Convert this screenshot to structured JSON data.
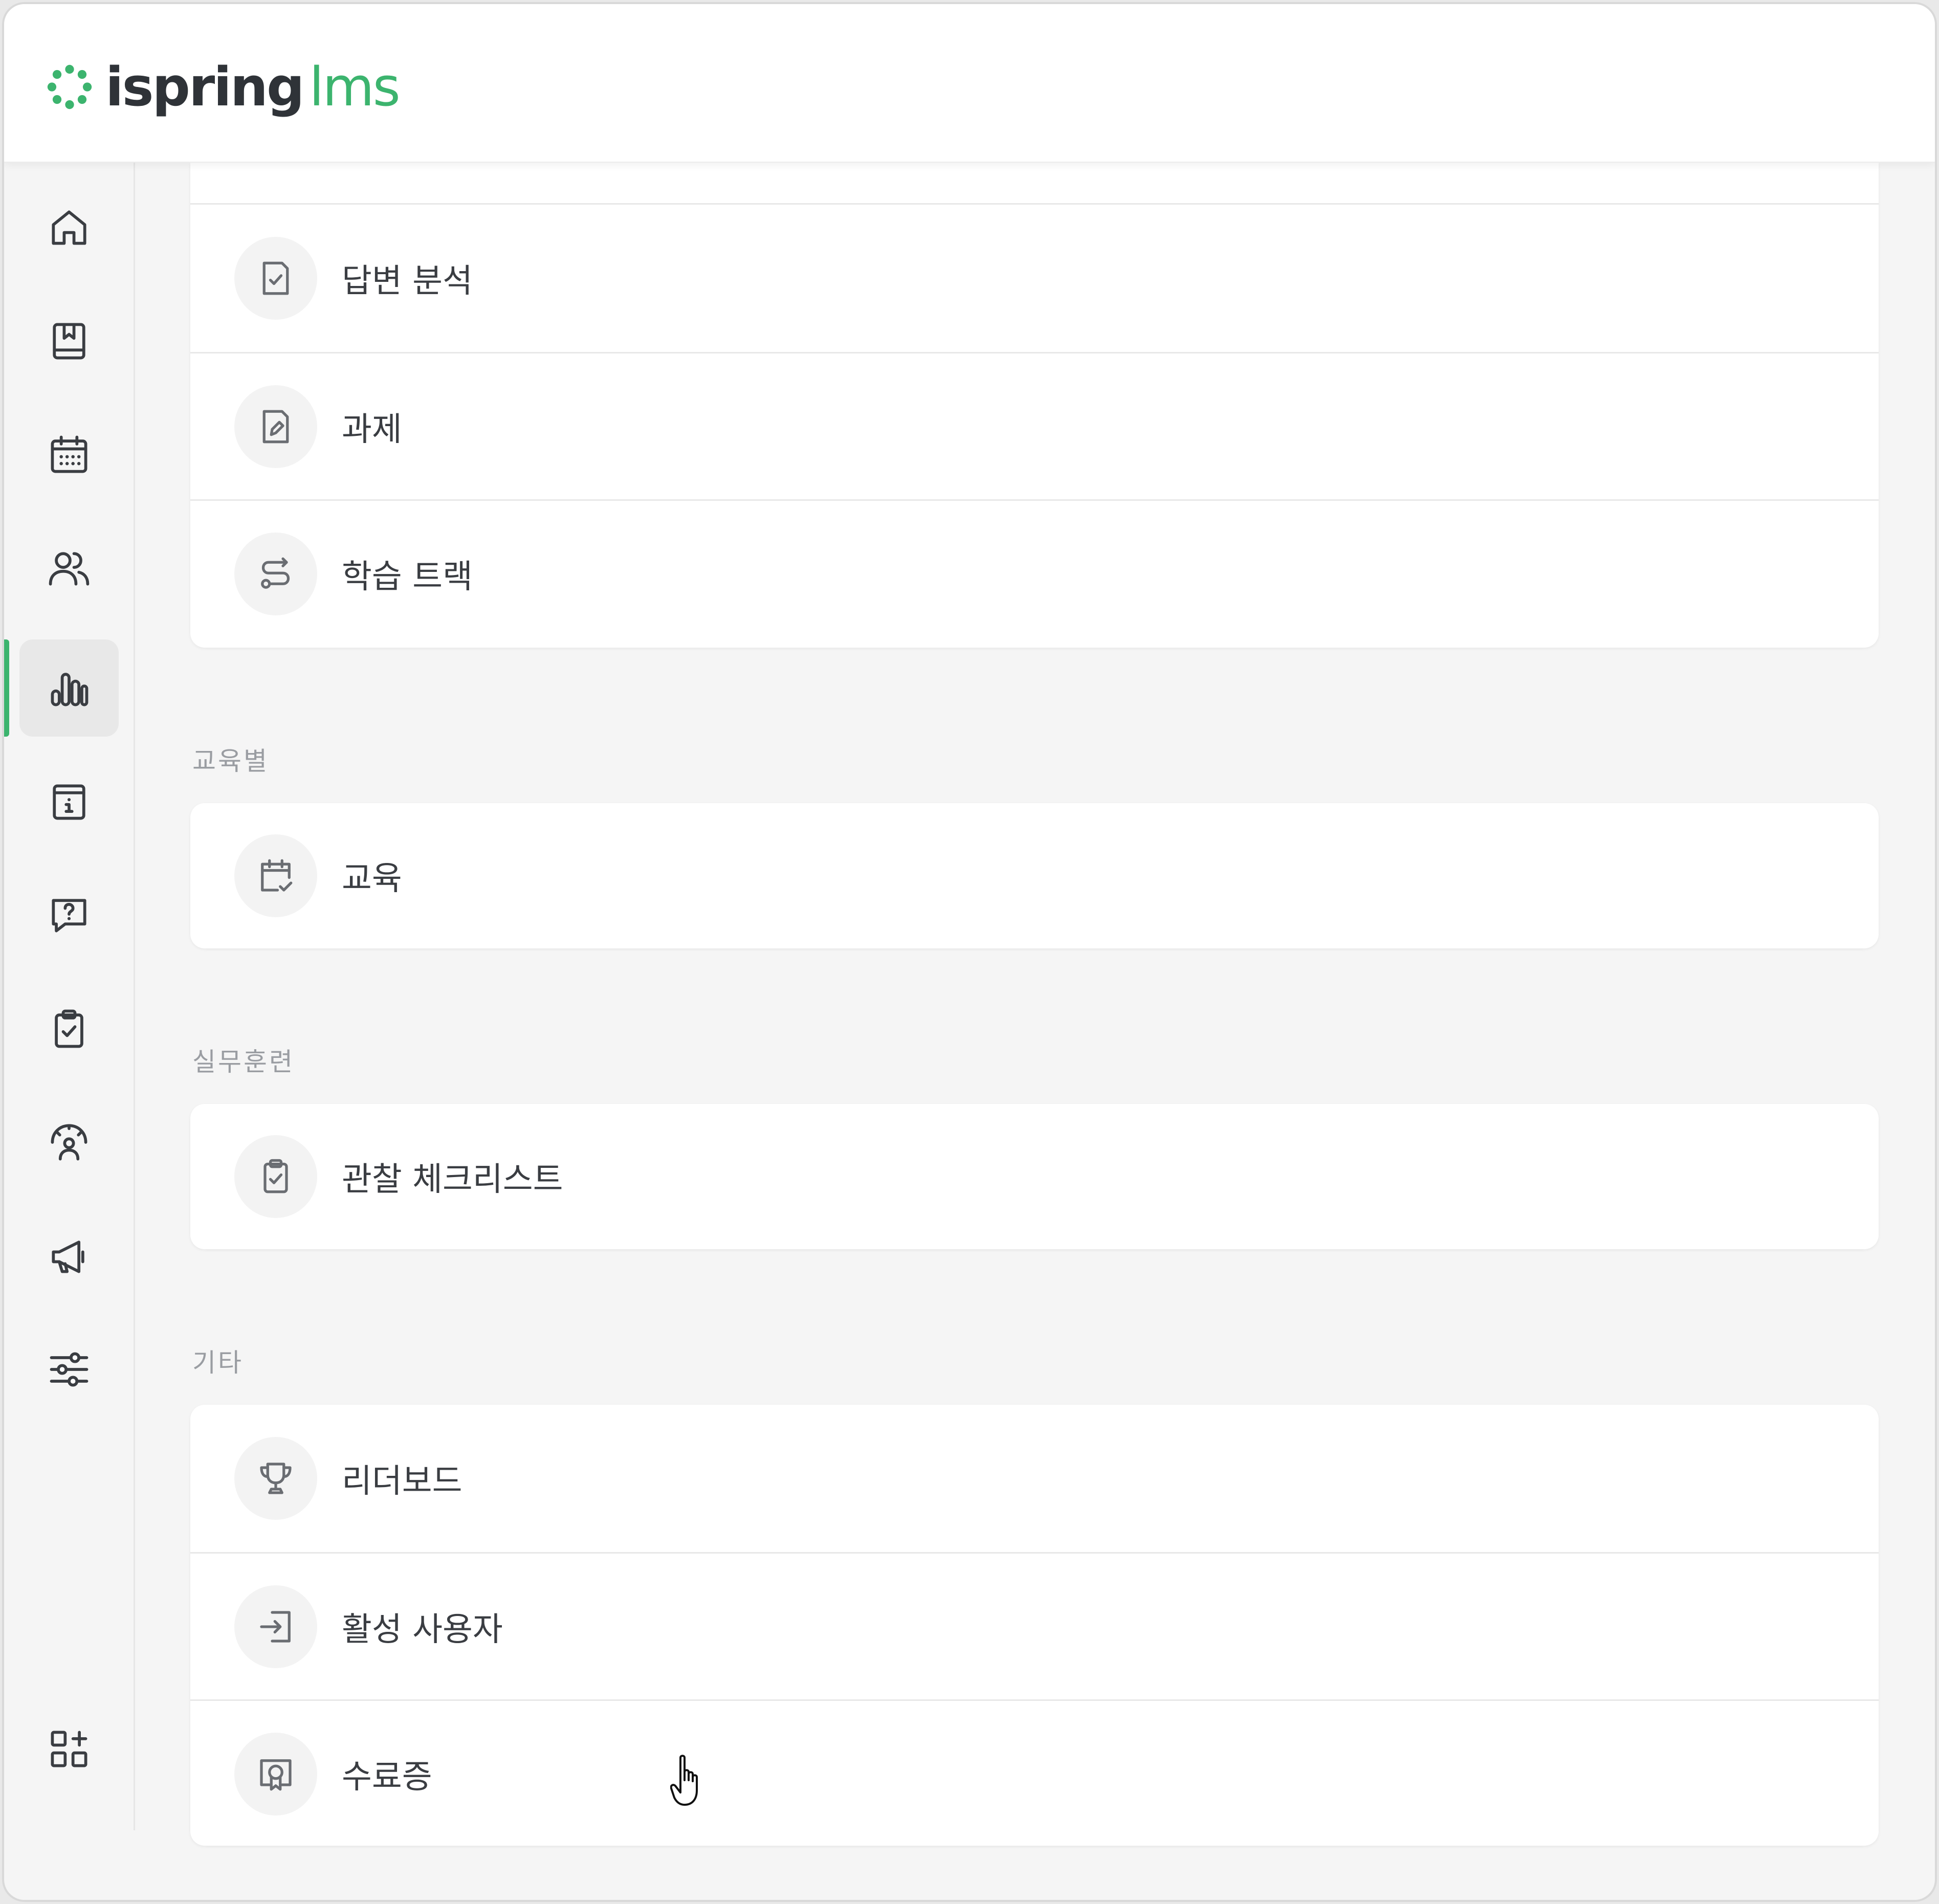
{
  "brand": {
    "name_primary": "ispring",
    "name_secondary": "lms",
    "accent_color": "#3cb46e"
  },
  "sidebar": {
    "active_index": 4,
    "items": [
      {
        "icon": "home-icon"
      },
      {
        "icon": "book-icon"
      },
      {
        "icon": "calendar-icon"
      },
      {
        "icon": "users-icon"
      },
      {
        "icon": "bar-chart-icon"
      },
      {
        "icon": "info-page-icon"
      },
      {
        "icon": "question-chat-icon"
      },
      {
        "icon": "clipboard-check-icon"
      },
      {
        "icon": "gauge-user-icon"
      },
      {
        "icon": "megaphone-icon"
      },
      {
        "icon": "sliders-icon"
      },
      {
        "icon": "apps-add-icon"
      }
    ]
  },
  "sections": {
    "top_group": {
      "items": [
        {
          "label": "답변 분석",
          "icon": "document-check-icon"
        },
        {
          "label": "과제",
          "icon": "document-edit-icon"
        },
        {
          "label": "학습 트랙",
          "icon": "route-icon"
        }
      ]
    },
    "by_training": {
      "title": "교육별",
      "items": [
        {
          "label": "교육",
          "icon": "calendar-check-icon"
        }
      ]
    },
    "practical": {
      "title": "실무훈련",
      "items": [
        {
          "label": "관찰 체크리스트",
          "icon": "clipboard-check-icon"
        }
      ]
    },
    "other": {
      "title": "기타",
      "items": [
        {
          "label": "리더보드",
          "icon": "trophy-icon"
        },
        {
          "label": "활성 사용자",
          "icon": "login-icon"
        },
        {
          "label": "수료증",
          "icon": "certificate-icon"
        }
      ]
    }
  }
}
